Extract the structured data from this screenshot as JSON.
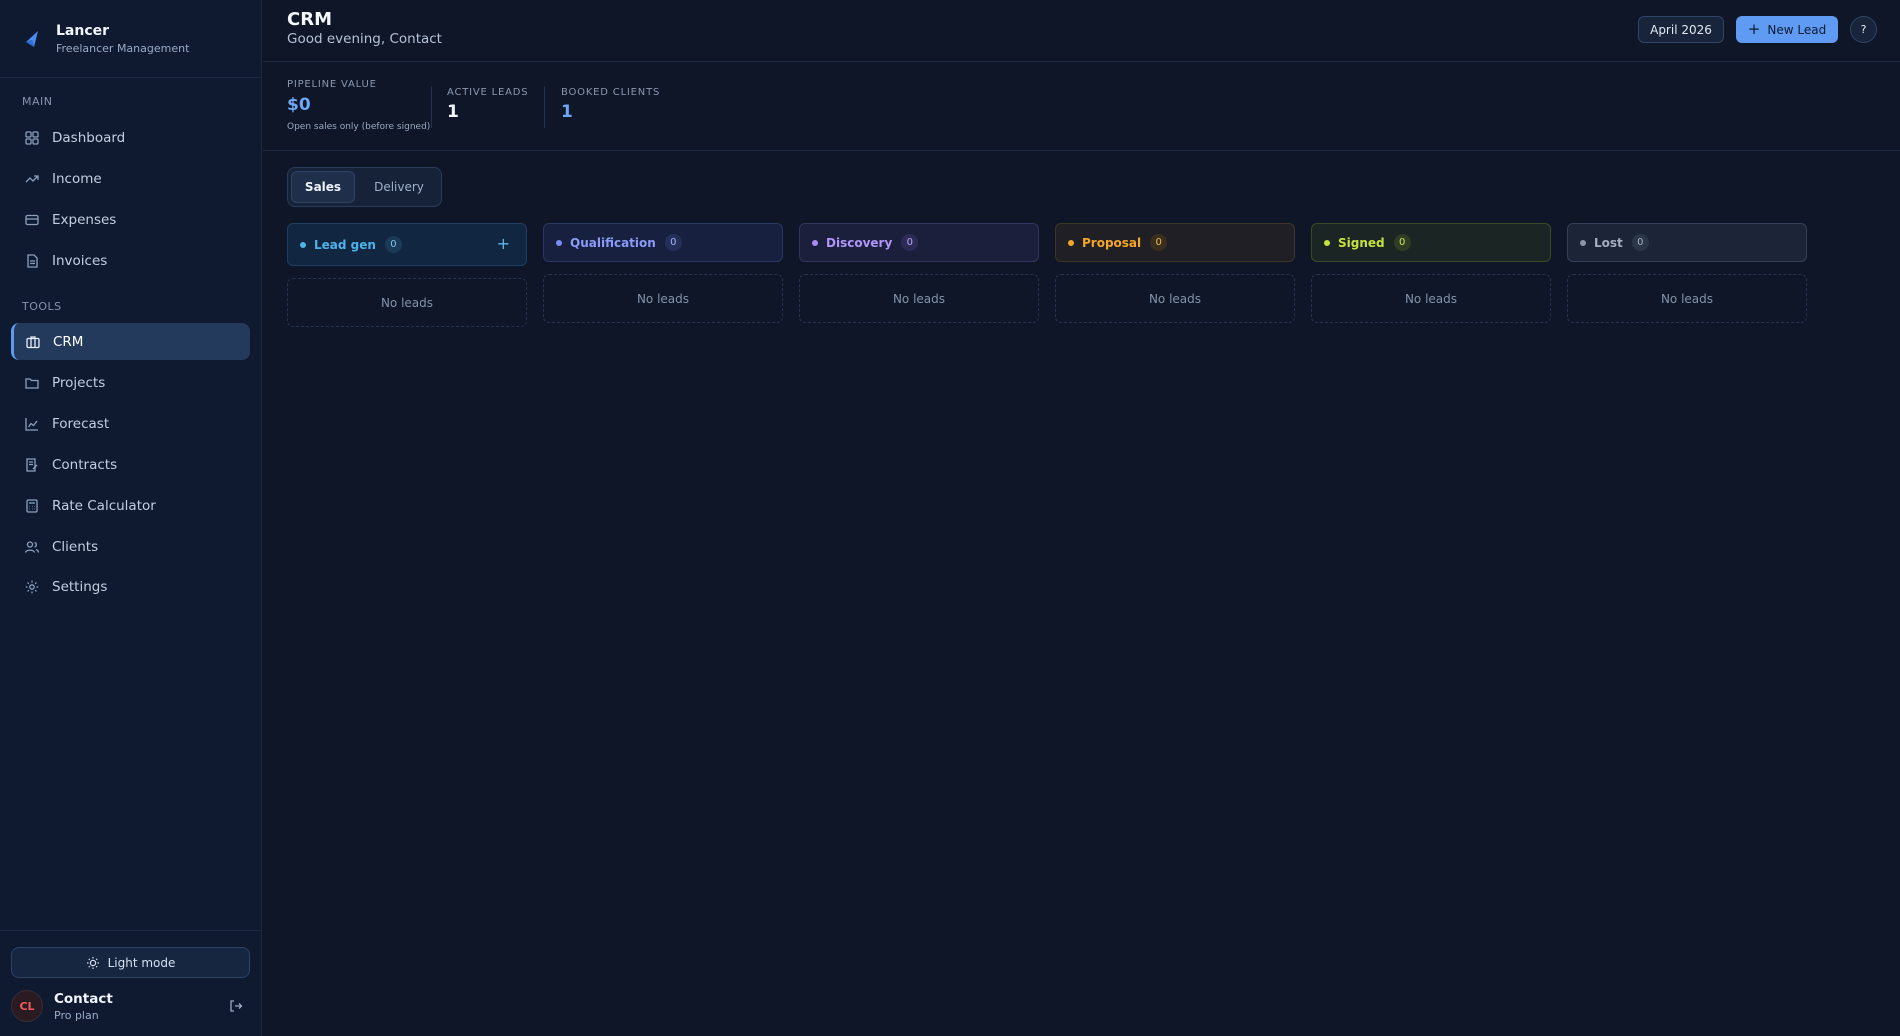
{
  "app": {
    "name": "Lancer",
    "subtitle": "Freelancer Management"
  },
  "sidebar": {
    "main_label": "MAIN",
    "tools_label": "TOOLS",
    "main_items": [
      {
        "label": "Dashboard",
        "icon": "dashboard-icon"
      },
      {
        "label": "Income",
        "icon": "trending-up-icon"
      },
      {
        "label": "Expenses",
        "icon": "credit-card-icon"
      },
      {
        "label": "Invoices",
        "icon": "file-text-icon"
      }
    ],
    "tools_items": [
      {
        "label": "CRM",
        "icon": "briefcase-icon",
        "active": true
      },
      {
        "label": "Projects",
        "icon": "folder-icon"
      },
      {
        "label": "Forecast",
        "icon": "line-chart-icon"
      },
      {
        "label": "Contracts",
        "icon": "contract-icon"
      },
      {
        "label": "Rate Calculator",
        "icon": "calculator-icon"
      },
      {
        "label": "Clients",
        "icon": "users-icon"
      },
      {
        "label": "Settings",
        "icon": "gear-icon"
      }
    ],
    "light_mode_label": "Light mode",
    "user": {
      "initials": "CL",
      "name": "Contact",
      "plan": "Pro plan"
    }
  },
  "header": {
    "title": "CRM",
    "greeting": "Good evening, Contact",
    "month": "April 2026",
    "new_lead_label": "New Lead",
    "help_label": "?"
  },
  "stats": {
    "pipeline": {
      "label": "PIPELINE VALUE",
      "value": "$0",
      "note": "Open sales only (before signed)"
    },
    "active": {
      "label": "ACTIVE LEADS",
      "value": "1"
    },
    "booked": {
      "label": "BOOKED CLIENTS",
      "value": "1"
    }
  },
  "tabs": {
    "sales": "Sales",
    "delivery": "Delivery"
  },
  "colors": {
    "accent": "#5f9bf2",
    "lead_gen": "#4fb3ea",
    "qualification": "#7b8cf6",
    "discovery": "#a98af7",
    "proposal": "#f5a623",
    "signed": "#c6e33b",
    "lost": "#8e97a8"
  },
  "columns": [
    {
      "label": "Lead gen",
      "count": "0",
      "empty": "No leads"
    },
    {
      "label": "Qualification",
      "count": "0",
      "empty": "No leads"
    },
    {
      "label": "Discovery",
      "count": "0",
      "empty": "No leads"
    },
    {
      "label": "Proposal",
      "count": "0",
      "empty": "No leads"
    },
    {
      "label": "Signed",
      "count": "0",
      "empty": "No leads"
    },
    {
      "label": "Lost",
      "count": "0",
      "empty": "No leads"
    }
  ]
}
